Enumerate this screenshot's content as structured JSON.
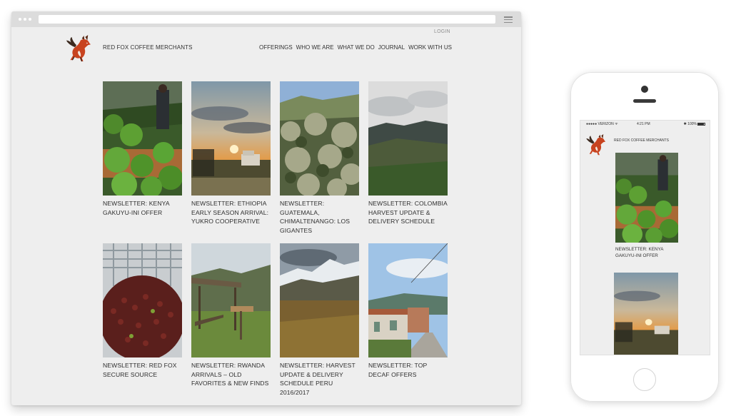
{
  "site": {
    "brand": "RED FOX COFFEE MERCHANTS",
    "login": "LOGIN",
    "nav": [
      "OFFERINGS",
      "WHO WE ARE",
      "WHAT WE DO",
      "JOURNAL",
      "WORK WITH US"
    ]
  },
  "posts": [
    {
      "title": "NEWSLETTER: KENYA GAKUYU-INI OFFER",
      "image": "coffee seedlings nursery"
    },
    {
      "title": "NEWSLETTER: ETHIOPIA EARLY SEASON ARRIVAL: YUKRO COOPERATIVE",
      "image": "sunset with truck"
    },
    {
      "title": "NEWSLETTER: GUATEMALA, CHIMALTENANGO: LOS GIGANTES",
      "image": "coffee trees on hillside"
    },
    {
      "title": "NEWSLETTER: COLOMBIA HARVEST UPDATE & DELIVERY SCHEDULE",
      "image": "mountain valley"
    },
    {
      "title": "NEWSLETTER: RED FOX SECURE SOURCE",
      "image": "basket of coffee cherries"
    },
    {
      "title": "NEWSLETTER: RWANDA ARRIVALS – OLD FAVORITES & NEW FINDS",
      "image": "drying shed and sign"
    },
    {
      "title": "NEWSLETTER: HARVEST UPDATE & DELIVERY SCHEDULE PERU 2016/2017",
      "image": "snowy mountains"
    },
    {
      "title": "NEWSLETTER: TOP DECAF OFFERS",
      "image": "village street"
    }
  ],
  "mobile": {
    "carrier": "●●●●● VERIZON ᯤ",
    "time": "4:21 PM",
    "battery": "✱ 100%",
    "brand": "RED FOX COFFEE MERCHANTS",
    "first_post": "NEWSLETTER: KENYA GAKUYU-INI OFFER"
  },
  "colors": {
    "page_bg": "#eeeeee",
    "text": "#333333",
    "fox": "#c8431f"
  }
}
